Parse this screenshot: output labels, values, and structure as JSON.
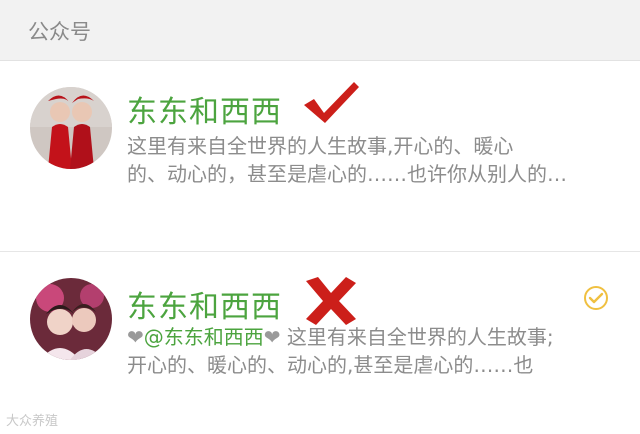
{
  "header": {
    "title": "公众号"
  },
  "results": [
    {
      "name": "东东和西西",
      "description_lines": [
        "这里有来自全世界的人生故事,开心的、暖心",
        "的、动心的，甚至是虐心的……也许你从别人的…"
      ],
      "mark": "checkmark-icon"
    },
    {
      "name": "东东和西西",
      "description_heart_left": "❤",
      "description_mention": "@东东和西西",
      "description_heart_right": "❤",
      "description_line1_rest": " 这里有来自全世界的人生故事;",
      "description_line2": "开心的、暖心的、动心的,甚至是虐心的……也",
      "mark": "cross-icon",
      "verified_icon": "verified-badge-icon"
    }
  ],
  "watermark": "大众养殖",
  "colors": {
    "name_green": "#4ca43f",
    "mark_red": "#cc1f1a",
    "badge_gold": "#f0c040"
  }
}
